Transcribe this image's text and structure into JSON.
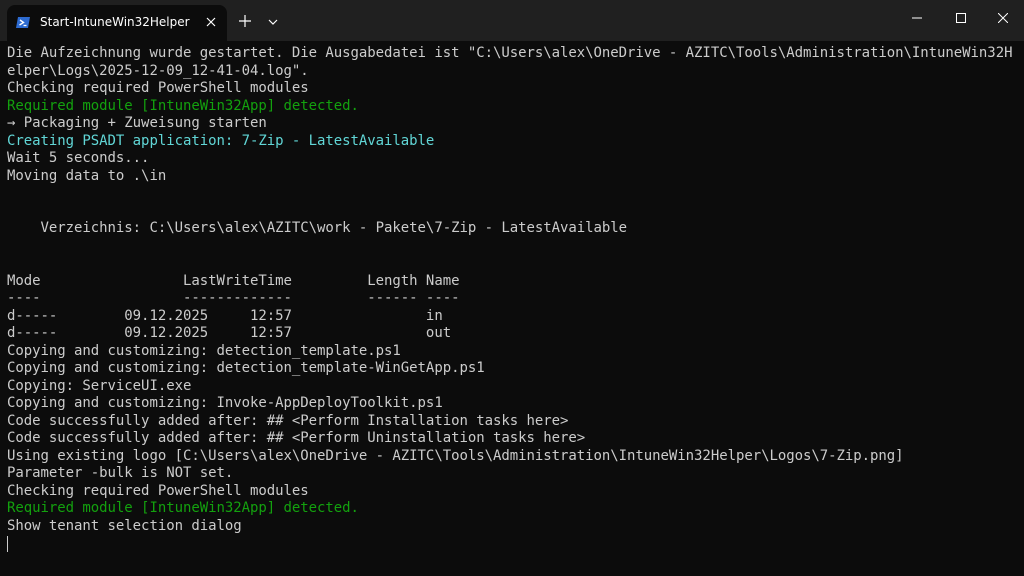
{
  "window": {
    "tab_title": "Start-IntuneWin32Helper",
    "tab_icon": "powershell-icon",
    "accent_color": "#2d6bd1"
  },
  "terminal": {
    "lines": [
      {
        "text": "Die Aufzeichnung wurde gestartet. Die Ausgabedatei ist \"C:\\Users\\alex\\OneDrive - AZITC\\Tools\\Administration\\IntuneWin32H",
        "color": "default"
      },
      {
        "text": "elper\\Logs\\2025-12-09_12-41-04.log\".",
        "color": "default"
      },
      {
        "text": "Checking required PowerShell modules",
        "color": "default"
      },
      {
        "text": "Required module [IntuneWin32App] detected.",
        "color": "green"
      },
      {
        "text": "→ Packaging + Zuweisung starten",
        "color": "default"
      },
      {
        "text": "Creating PSADT application: 7-Zip - LatestAvailable",
        "color": "cyan"
      },
      {
        "text": "Wait 5 seconds...",
        "color": "default"
      },
      {
        "text": "Moving data to .\\in",
        "color": "default"
      },
      {
        "text": "",
        "color": "default"
      },
      {
        "text": "",
        "color": "default"
      },
      {
        "text": "    Verzeichnis: C:\\Users\\alex\\AZITC\\work - Pakete\\7-Zip - LatestAvailable",
        "color": "default"
      },
      {
        "text": "",
        "color": "default"
      },
      {
        "text": "",
        "color": "default"
      },
      {
        "text": "Mode                 LastWriteTime         Length Name",
        "color": "default"
      },
      {
        "text": "----                 -------------         ------ ----",
        "color": "default"
      },
      {
        "text": "d-----        09.12.2025     12:57                in",
        "color": "default"
      },
      {
        "text": "d-----        09.12.2025     12:57                out",
        "color": "default"
      },
      {
        "text": "Copying and customizing: detection_template.ps1",
        "color": "default"
      },
      {
        "text": "Copying and customizing: detection_template-WinGetApp.ps1",
        "color": "default"
      },
      {
        "text": "Copying: ServiceUI.exe",
        "color": "default"
      },
      {
        "text": "Copying and customizing: Invoke-AppDeployToolkit.ps1",
        "color": "default"
      },
      {
        "text": "Code successfully added after: ## <Perform Installation tasks here>",
        "color": "default"
      },
      {
        "text": "Code successfully added after: ## <Perform Uninstallation tasks here>",
        "color": "default"
      },
      {
        "text": "Using existing logo [C:\\Users\\alex\\OneDrive - AZITC\\Tools\\Administration\\IntuneWin32Helper\\Logos\\7-Zip.png]",
        "color": "default"
      },
      {
        "text": "Parameter -bulk is NOT set.",
        "color": "default"
      },
      {
        "text": "Checking required PowerShell modules",
        "color": "default"
      },
      {
        "text": "Required module [IntuneWin32App] detected.",
        "color": "green"
      },
      {
        "text": "Show tenant selection dialog",
        "color": "default"
      }
    ]
  }
}
